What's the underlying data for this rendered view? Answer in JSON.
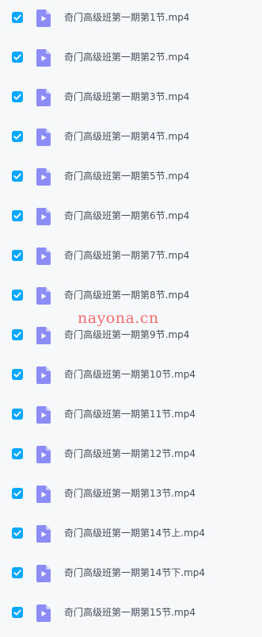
{
  "files": [
    {
      "name": "奇门高级班第一期第1节.mp4",
      "checked": true
    },
    {
      "name": "奇门高级班第一期第2节.mp4",
      "checked": true
    },
    {
      "name": "奇门高级班第一期第3节.mp4",
      "checked": true
    },
    {
      "name": "奇门高级班第一期第4节.mp4",
      "checked": true
    },
    {
      "name": "奇门高级班第一期第5节.mp4",
      "checked": true
    },
    {
      "name": "奇门高级班第一期第6节.mp4",
      "checked": true
    },
    {
      "name": "奇门高级班第一期第7节.mp4",
      "checked": true
    },
    {
      "name": "奇门高级班第一期第8节.mp4",
      "checked": true
    },
    {
      "name": "奇门高级班第一期第9节.mp4",
      "checked": true
    },
    {
      "name": "奇门高级班第一期第10节.mp4",
      "checked": true
    },
    {
      "name": "奇门高级班第一期第11节.mp4",
      "checked": true
    },
    {
      "name": "奇门高级班第一期第12节.mp4",
      "checked": true
    },
    {
      "name": "奇门高级班第一期第13节.mp4",
      "checked": true
    },
    {
      "name": "奇门高级班第一期第14节上.mp4",
      "checked": true
    },
    {
      "name": "奇门高级班第一期第14节下.mp4",
      "checked": true
    },
    {
      "name": "奇门高级班第一期第15节.mp4",
      "checked": true
    }
  ],
  "icons": {
    "checkbox": "checkbox-checked-icon",
    "file": "video-file-icon"
  },
  "colors": {
    "checkbox": "#06a7ff",
    "file_icon": "#8c8cf7",
    "file_icon_fold": "#c9c9ff",
    "text": "#454d5a",
    "background": "#f7f8fa",
    "watermark": "#f26d6d"
  },
  "watermark": "nayona.cn"
}
